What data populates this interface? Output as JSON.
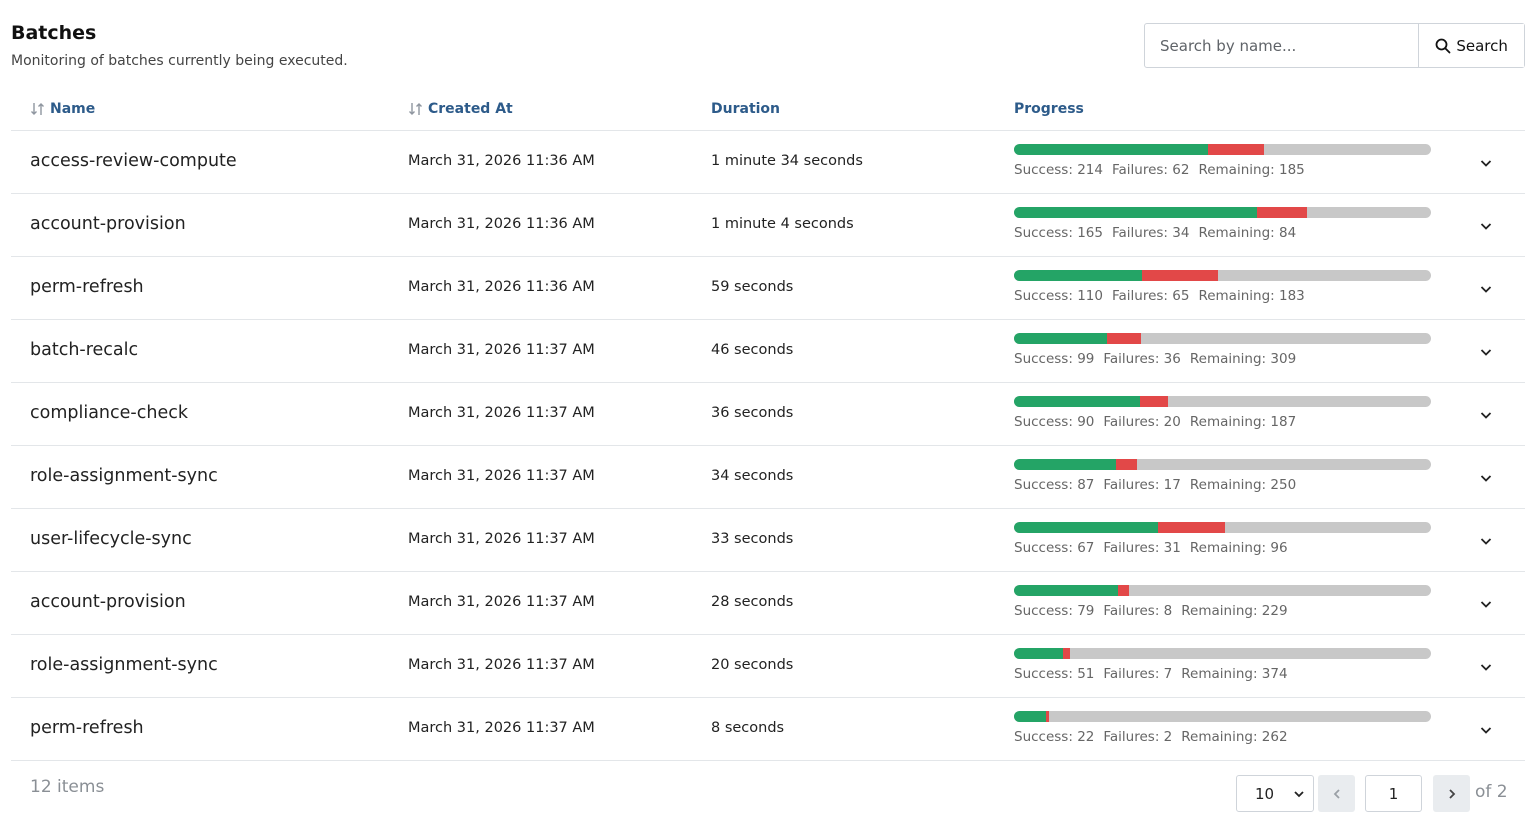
{
  "header": {
    "title": "Batches",
    "subtitle": "Monitoring of batches currently being executed."
  },
  "search": {
    "placeholder": "Search by name...",
    "button_label": "Search",
    "icon": "search-icon"
  },
  "table": {
    "columns": {
      "name": "Name",
      "created_at": "Created At",
      "duration": "Duration",
      "progress": "Progress"
    },
    "stat_labels": {
      "success": "Success: ",
      "failures": "Failures: ",
      "remaining": "Remaining: "
    },
    "rows": [
      {
        "name": "access-review-compute",
        "created_at": "March 31, 2026 11:36 AM",
        "duration": "1 minute 34 seconds",
        "success": 214,
        "failures": 62,
        "remaining": 185
      },
      {
        "name": "account-provision",
        "created_at": "March 31, 2026 11:36 AM",
        "duration": "1 minute 4 seconds",
        "success": 165,
        "failures": 34,
        "remaining": 84
      },
      {
        "name": "perm-refresh",
        "created_at": "March 31, 2026 11:36 AM",
        "duration": "59 seconds",
        "success": 110,
        "failures": 65,
        "remaining": 183
      },
      {
        "name": "batch-recalc",
        "created_at": "March 31, 2026 11:37 AM",
        "duration": "46 seconds",
        "success": 99,
        "failures": 36,
        "remaining": 309
      },
      {
        "name": "compliance-check",
        "created_at": "March 31, 2026 11:37 AM",
        "duration": "36 seconds",
        "success": 90,
        "failures": 20,
        "remaining": 187
      },
      {
        "name": "role-assignment-sync",
        "created_at": "March 31, 2026 11:37 AM",
        "duration": "34 seconds",
        "success": 87,
        "failures": 17,
        "remaining": 250
      },
      {
        "name": "user-lifecycle-sync",
        "created_at": "March 31, 2026 11:37 AM",
        "duration": "33 seconds",
        "success": 67,
        "failures": 31,
        "remaining": 96
      },
      {
        "name": "account-provision",
        "created_at": "March 31, 2026 11:37 AM",
        "duration": "28 seconds",
        "success": 79,
        "failures": 8,
        "remaining": 229
      },
      {
        "name": "role-assignment-sync",
        "created_at": "March 31, 2026 11:37 AM",
        "duration": "20 seconds",
        "success": 51,
        "failures": 7,
        "remaining": 374
      },
      {
        "name": "perm-refresh",
        "created_at": "March 31, 2026 11:37 AM",
        "duration": "8 seconds",
        "success": 22,
        "failures": 2,
        "remaining": 262
      }
    ]
  },
  "footer": {
    "items_count": "12 items",
    "page_size": "10",
    "current_page": "1",
    "of_pages": "of 2"
  },
  "colors": {
    "success": "#24a466",
    "failure": "#e24848",
    "remaining": "#c8c8c8",
    "header_link": "#2d5b8a"
  }
}
